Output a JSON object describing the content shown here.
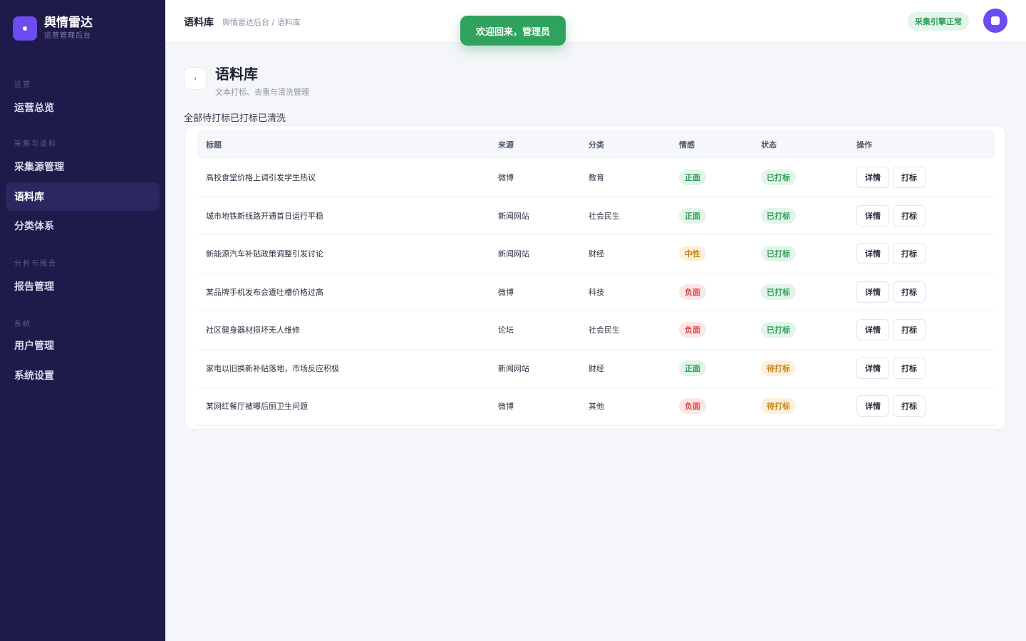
{
  "brand": {
    "title": "舆情雷达",
    "subtitle": "运营管理后台"
  },
  "sidebar": {
    "groups": [
      "运营",
      "采集与语料",
      "分析与报告",
      "系统"
    ],
    "items": [
      {
        "label": "运营总览"
      },
      {
        "label": "采集源管理"
      },
      {
        "label": "语料库"
      },
      {
        "label": "分类体系"
      },
      {
        "label": "报告管理"
      },
      {
        "label": "用户管理"
      },
      {
        "label": "系统设置"
      }
    ]
  },
  "header": {
    "title": "语料库",
    "breadcrumb": "舆情雷达后台 / 语料库",
    "status": "采集引擎正常"
  },
  "toast": "欢迎回来，管理员",
  "page": {
    "back_glyph": "‹",
    "title": "语料库",
    "subtitle": "文本打标、去重与清洗管理",
    "filters": [
      "全部",
      "待打标",
      "已打标",
      "已清洗"
    ]
  },
  "table": {
    "columns": [
      "标题",
      "来源",
      "分类",
      "情感",
      "状态",
      "操作"
    ],
    "actions": [
      "详情",
      "打标"
    ],
    "rows": [
      {
        "title": "高校食堂价格上调引发学生热议",
        "source": "微博",
        "category": "教育",
        "sentiment": "正面",
        "status": "已打标"
      },
      {
        "title": "城市地铁新线路开通首日运行平稳",
        "source": "新闻网站",
        "category": "社会民生",
        "sentiment": "正面",
        "status": "已打标"
      },
      {
        "title": "新能源汽车补贴政策调整引发讨论",
        "source": "新闻网站",
        "category": "财经",
        "sentiment": "中性",
        "status": "已打标"
      },
      {
        "title": "某品牌手机发布会遭吐槽价格过高",
        "source": "微博",
        "category": "科技",
        "sentiment": "负面",
        "status": "已打标"
      },
      {
        "title": "社区健身器材损坏无人维修",
        "source": "论坛",
        "category": "社会民生",
        "sentiment": "负面",
        "status": "已打标"
      },
      {
        "title": "家电以旧换新补贴落地，市场反应积极",
        "source": "新闻网站",
        "category": "财经",
        "sentiment": "正面",
        "status": "待打标"
      },
      {
        "title": "某网红餐厅被曝后厨卫生问题",
        "source": "微博",
        "category": "其他",
        "sentiment": "负面",
        "status": "待打标"
      }
    ]
  },
  "colors": {
    "sidebar_bg": "#1e1a4a",
    "accent": "#6c4cf1",
    "success": "#2fa35e",
    "warning": "#c98512",
    "danger": "#d94a4a"
  }
}
